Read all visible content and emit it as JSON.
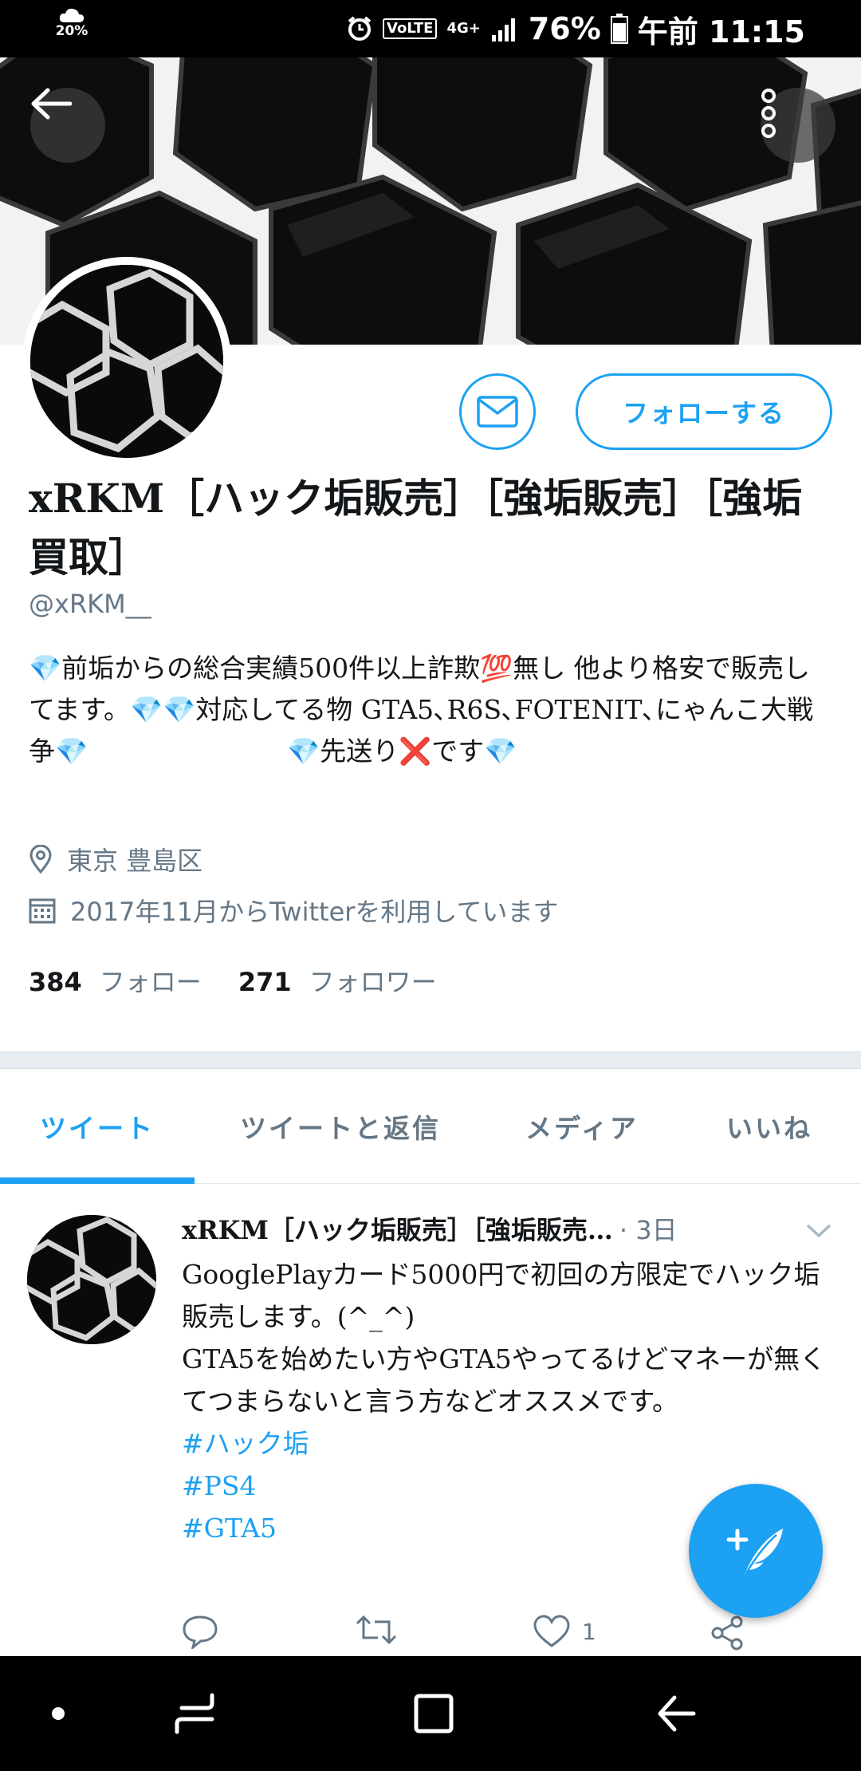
{
  "status_bar": {
    "weather_percent": "20%",
    "volte": "VoLTE",
    "network": "4G+",
    "battery": "76%",
    "time": "午前 11:15"
  },
  "profile": {
    "display_name": "xRKM［ハック垢販売］［強垢販売］［強垢買取］",
    "handle": "@xRKM__",
    "follow_label": "フォローする",
    "bio": {
      "gem": "💎",
      "p1": "前垢からの総合実績500件以上詐欺",
      "hundred": "💯",
      "p2": "無し 他より格安で販売してます。",
      "p3": "対応してる物 GTA5､R6S､FOTENIT､にゃんこ大戦争",
      "p4": "先送り",
      "cross": "❌",
      "p5": "です"
    },
    "location": "東京 豊島区",
    "joined": "2017年11月からTwitterを利用しています",
    "following_count": "384",
    "following_label": "フォロー",
    "followers_count": "271",
    "followers_label": "フォロワー"
  },
  "tabs": [
    "ツイート",
    "ツイートと返信",
    "メディア",
    "いいね"
  ],
  "tweet": {
    "name": "xRKM［ハック垢販売］［強垢販売…",
    "time": "· 3日",
    "text_1": "GooglePlayカード5000円で初回の方限定でハック垢販売します。(^_^)",
    "text_2": "GTA5を始めたい方やGTA5やってるけどマネーが無くてつまらないと言う方などオススメです。",
    "hashtags": [
      "#ハック垢",
      "#PS4",
      "#GTA5"
    ],
    "like_count": "1"
  },
  "colors": {
    "accent": "#1da1f2",
    "secondary_text": "#657786",
    "gem": "#e040fb"
  }
}
